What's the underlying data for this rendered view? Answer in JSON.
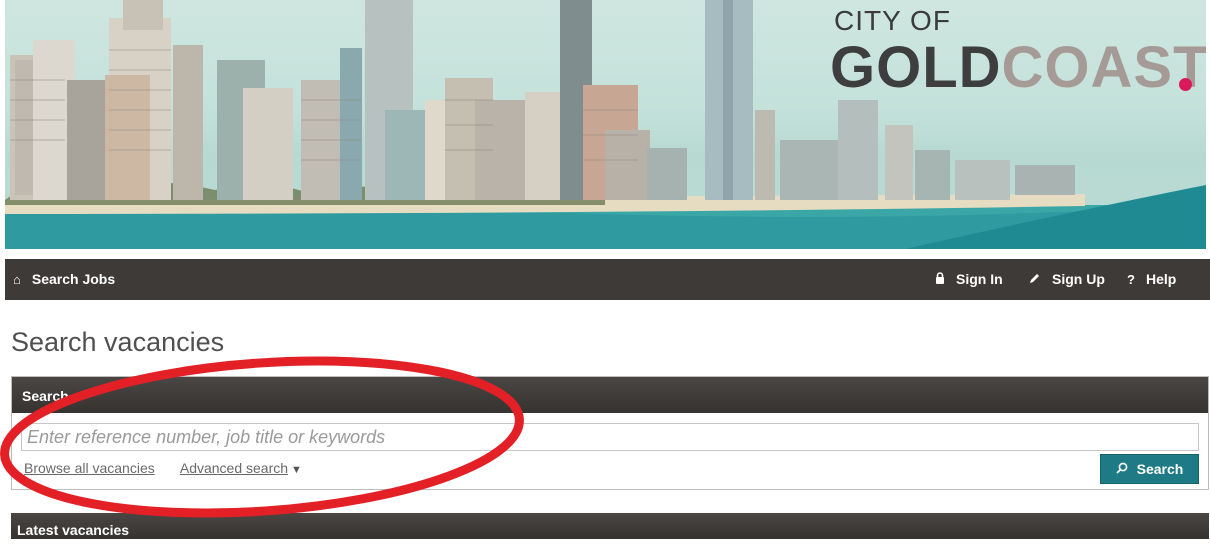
{
  "banner": {
    "logo_line1": "CITY OF",
    "logo_gold": "GOLD",
    "logo_coast": "COAST",
    "logo_dot_color": "#d9195a",
    "logo_gold_color": "#3e3e3e",
    "logo_coast_color": "#a59a95"
  },
  "nav": {
    "search_jobs": "Search Jobs",
    "sign_in": "Sign In",
    "sign_up": "Sign Up",
    "help": "Help",
    "icons": {
      "home": "home-icon",
      "lock": "lock-icon",
      "pencil": "pencil-icon",
      "help": "question-icon"
    }
  },
  "page": {
    "title": "Search vacancies"
  },
  "search_panel": {
    "header": "Search",
    "input_placeholder": "Enter reference number, job title or keywords",
    "input_value": "",
    "browse_all": "Browse all vacancies",
    "advanced_search": "Advanced search",
    "search_button": "Search",
    "button_color": "#1e7b86"
  },
  "latest_vacancies": {
    "header": "Latest vacancies"
  },
  "annotation": {
    "color": "#e32026"
  }
}
